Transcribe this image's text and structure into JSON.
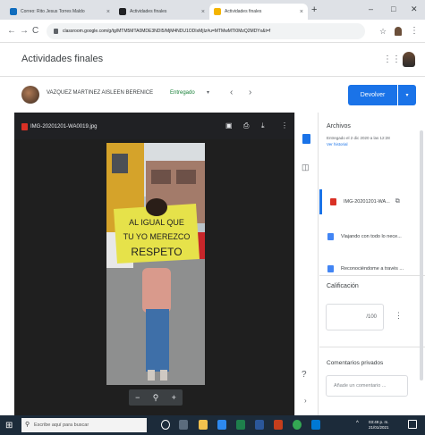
{
  "browser": {
    "tabs": [
      {
        "label": "Correo: Rito Jesus Torres Maldo",
        "favicon_color": "#0f6cbd",
        "active": false
      },
      {
        "label": "Actividades finales",
        "favicon_color": "#202124",
        "active": false
      },
      {
        "label": "Actividades finales",
        "favicon_color": "#f4b400",
        "active": true
      }
    ],
    "url": "classroom.google.com/g/tg/MTM5MTA0MDE3NDI5/MjM4NDU1ODIxMjIz#u=MTMwMTI0MzQ2MDYx&t=f"
  },
  "header": {
    "title": "Actividades finales"
  },
  "student": {
    "name": "VAZQUEZ MARTINEZ AISLEEN BERENICE",
    "status": "Entregado",
    "return_label": "Devolver"
  },
  "viewer": {
    "filename": "IMG-20201201-WA0019.jpg",
    "sign_text": "AL IGUAL QUE TU YO MEREZCO RESPETO"
  },
  "panel": {
    "files_title": "Archivos",
    "files_subtitle": "Entregado el 2 dic 2020 a las 12:28",
    "history_link": "Ver historial",
    "files": [
      {
        "name": "IMG-20201201-WA...",
        "icon_color": "#d93025"
      },
      {
        "name": "Viajando con todo lo nece...",
        "icon_color": "#4285f4"
      },
      {
        "name": "Reconociéndome a través ...",
        "icon_color": "#4285f4"
      }
    ],
    "grade_title": "Calificación",
    "grade_denominator": "/100",
    "comments_title": "Comentarios privados",
    "comment_placeholder": "Añade un comentario ..."
  },
  "taskbar": {
    "search_placeholder": "Escribe aquí para buscar",
    "time": "03:49 p. m.",
    "date": "21/01/2021"
  }
}
